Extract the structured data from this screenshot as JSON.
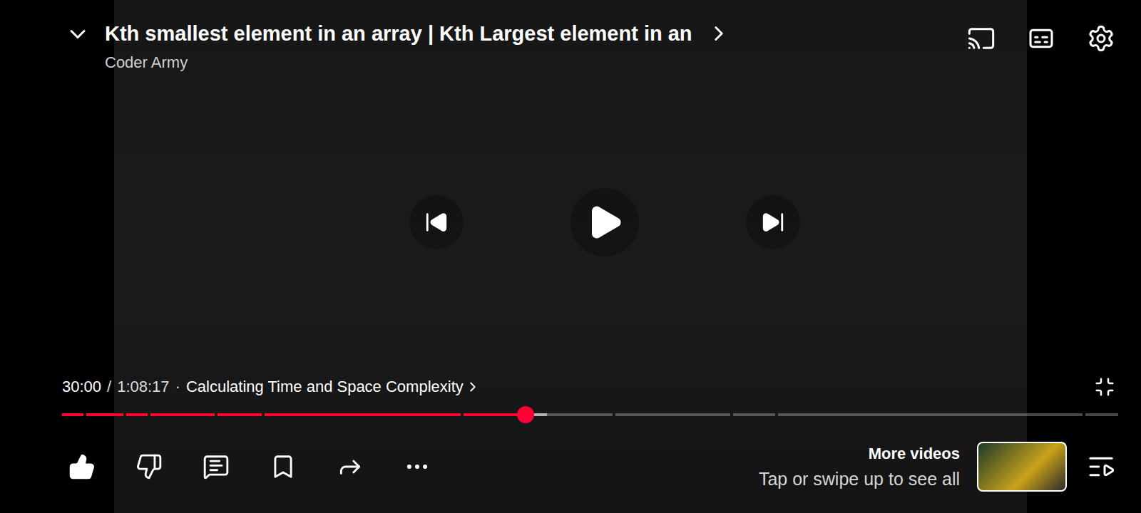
{
  "video": {
    "title": "Kth smallest element in an array | Kth Largest element in an",
    "channel": "Coder Army"
  },
  "player": {
    "playing": false,
    "captions": false,
    "current_time": "30:00",
    "separator": "/",
    "duration": "1:08:17",
    "bullet": "·",
    "chapter": "Calculating Time and Space Complexity",
    "progress": {
      "level": 0.439,
      "buffered": 0.455,
      "chapters": [
        0.021,
        0.057,
        0.078,
        0.14,
        0.183,
        0.374,
        0.519,
        0.631,
        0.672,
        0.968,
        1
      ]
    }
  },
  "actions": [
    {
      "kind": "like",
      "selected": true
    },
    {
      "kind": "dislike",
      "selected": false
    },
    {
      "kind": "comments",
      "selected": false
    },
    {
      "kind": "save",
      "selected": false
    },
    {
      "kind": "share",
      "selected": false
    },
    {
      "kind": "more",
      "selected": false
    }
  ],
  "more_videos": {
    "title": "More videos",
    "subtitle": "Tap or swipe up to see all"
  }
}
